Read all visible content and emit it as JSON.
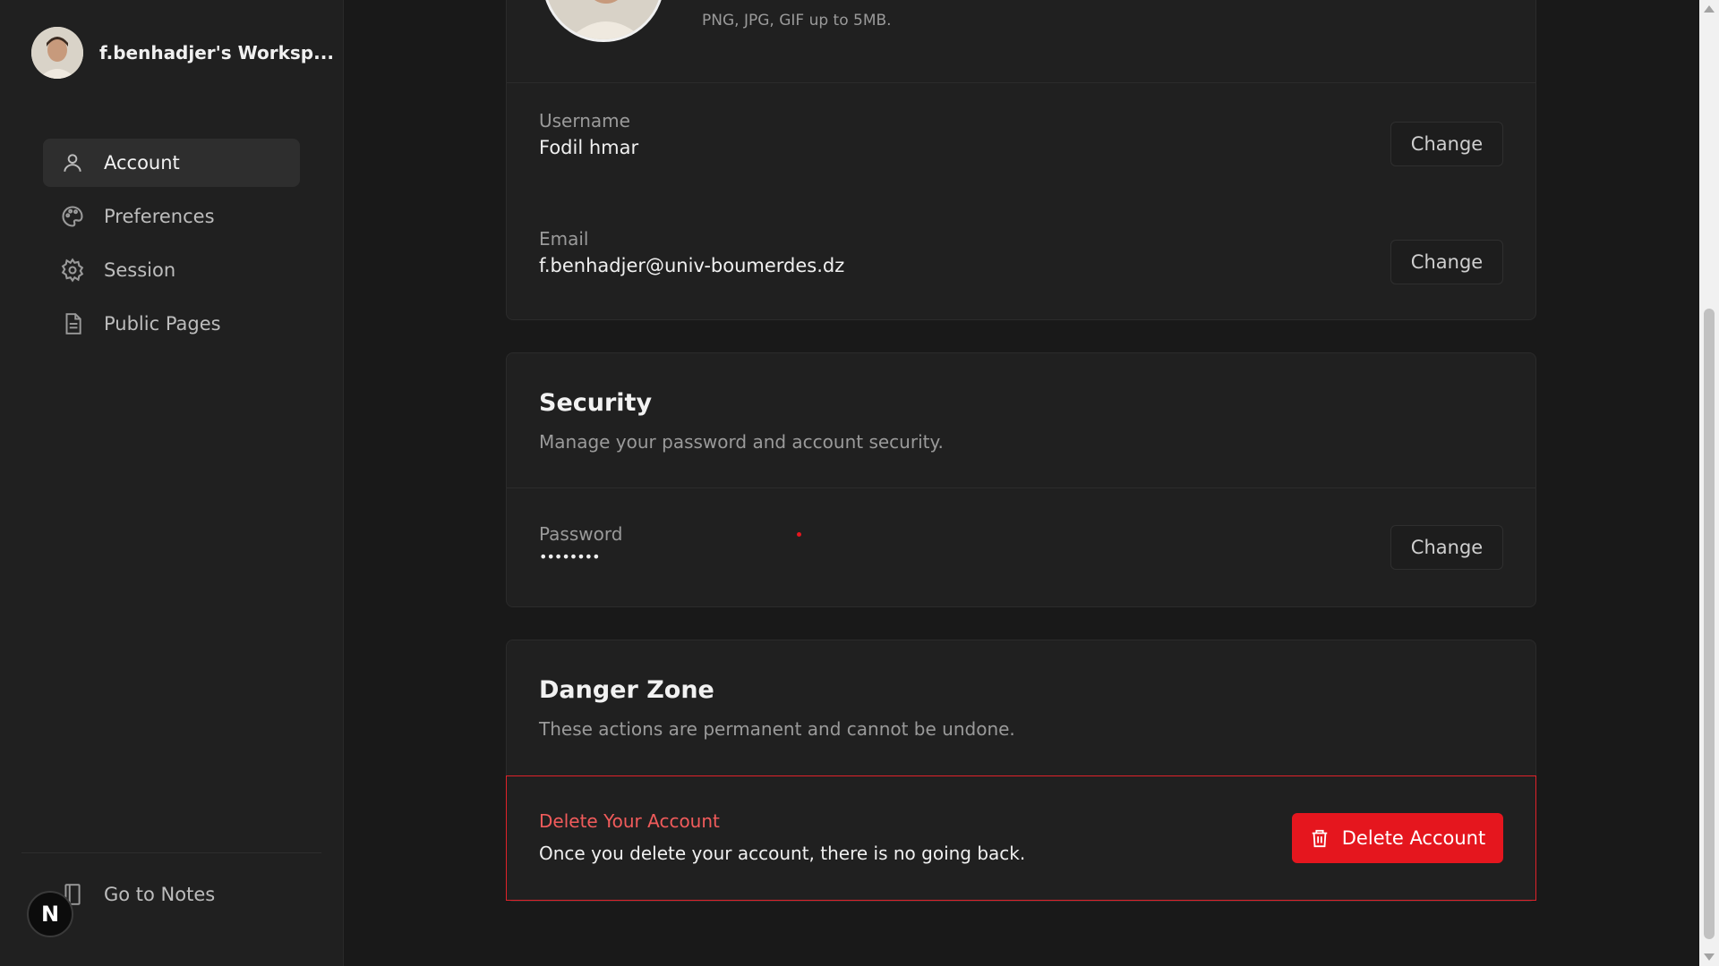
{
  "sidebar": {
    "workspace_name": "f.benhadjer's Worksp...",
    "items": [
      {
        "label": "Account",
        "icon": "user-icon",
        "active": true
      },
      {
        "label": "Preferences",
        "icon": "palette-icon",
        "active": false
      },
      {
        "label": "Session",
        "icon": "gear-icon",
        "active": false
      },
      {
        "label": "Public Pages",
        "icon": "document-icon",
        "active": false
      }
    ],
    "go_to_notes": "Go to Notes",
    "badge_letter": "N"
  },
  "profile": {
    "hint": "PNG, JPG, GIF up to 5MB."
  },
  "account": {
    "username_label": "Username",
    "username_value": "Fodil hmar",
    "email_label": "Email",
    "email_value": "f.benhadjer@univ-boumerdes.dz",
    "change_label": "Change"
  },
  "security": {
    "title": "Security",
    "description": "Manage your password and account security.",
    "password_label": "Password",
    "password_value": "••••••••",
    "change_label": "Change"
  },
  "danger": {
    "title": "Danger Zone",
    "description": "These actions are permanent and cannot be undone.",
    "delete_title": "Delete Your Account",
    "delete_desc": "Once you delete your account, there is no going back.",
    "delete_button": "Delete Account"
  },
  "colors": {
    "background": "#191919",
    "sidebar": "#202020",
    "danger": "#e5161e",
    "danger_text": "#f15b5b"
  }
}
